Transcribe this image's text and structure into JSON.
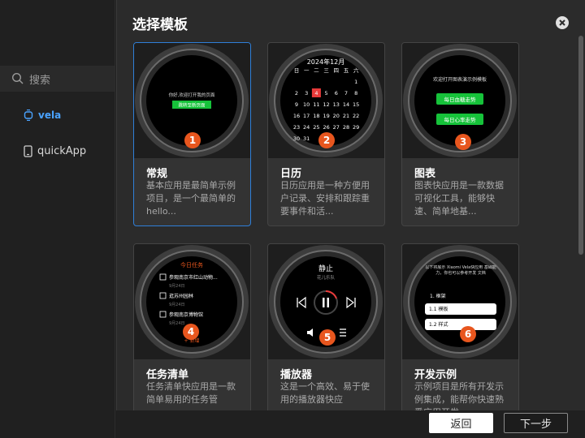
{
  "sidebar": {
    "search": {
      "label": "搜索"
    },
    "items": [
      {
        "label": "vela"
      },
      {
        "label": "quickApp"
      }
    ]
  },
  "main": {
    "title": "选择模板",
    "cards": [
      {
        "name": "常规",
        "desc": "基本应用是最简单示例项目，是一个最简单的hello...",
        "badge": "1",
        "screen": {
          "line1": "你好,欢迎打开我的页面",
          "button": "跳转至新页面"
        }
      },
      {
        "name": "日历",
        "desc": "日历应用是一种方便用户记录、安排和跟踪重要事件和活...",
        "badge": "2",
        "screen": {
          "header": "2024年12月",
          "weekdays": [
            "日",
            "一",
            "二",
            "三",
            "四",
            "五",
            "六"
          ],
          "rows": [
            [
              "",
              "",
              "",
              "",
              "",
              "",
              "1"
            ],
            [
              "2",
              "3",
              "4",
              "5",
              "6",
              "7",
              "8"
            ],
            [
              "9",
              "10",
              "11",
              "12",
              "13",
              "14",
              "15"
            ],
            [
              "16",
              "17",
              "18",
              "19",
              "20",
              "21",
              "22"
            ],
            [
              "23",
              "24",
              "25",
              "26",
              "27",
              "28",
              "29"
            ],
            [
              "30",
              "31",
              "",
              "",
              "",
              "",
              ""
            ]
          ],
          "today": "4"
        }
      },
      {
        "name": "图表",
        "desc": "图表快应用是一款数据可视化工具，能够快速、简单地基...",
        "badge": "3",
        "screen": {
          "line1": "欢迎打开图表演示例模板",
          "button1": "每日血糖走势",
          "button2": "每日心率走势"
        }
      },
      {
        "name": "任务清单",
        "desc": "任务清单快应用是一款简单易用的任务管",
        "badge": "4",
        "screen": {
          "header": "今日任务",
          "tasks": [
            {
              "label": "参观南京市红山动物...",
              "date": "9月24日"
            },
            {
              "label": "逛苏州园林",
              "date": "9月24日"
            },
            {
              "label": "参观南京博物馆",
              "date": "9月24日"
            }
          ],
          "footer": "+ 新增"
        }
      },
      {
        "name": "播放器",
        "desc": "这是一个高效、易于使用的播放器快应",
        "badge": "5",
        "screen": {
          "title": "静止",
          "artist": "花儿乐队"
        }
      },
      {
        "name": "开发示例",
        "desc": "示例项目是所有开发示例集成，能帮你快速熟悉应用开发...",
        "badge": "6",
        "screen": {
          "intro": "以下将展示 Xiaomi Vela快应用 基础能力，你也可以参考开发 文档",
          "section": "1. 框架",
          "item1": "1.1 模板",
          "item2": "1.2 样式"
        }
      }
    ]
  },
  "footer": {
    "back_label": "返回",
    "next_label": "下一步"
  }
}
